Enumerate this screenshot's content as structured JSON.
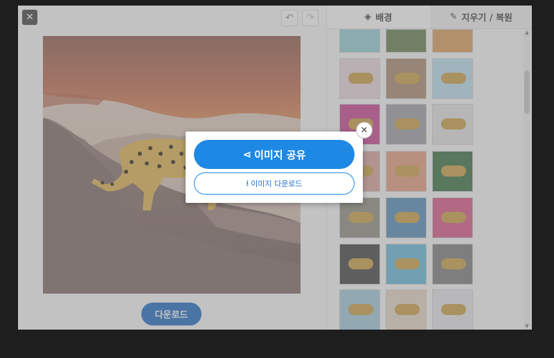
{
  "toolbar": {
    "close_icon": "close-icon",
    "undo_icon": "undo-icon",
    "redo_icon": "redo-icon"
  },
  "tabs": [
    {
      "label": "배경",
      "icon": "layers-icon"
    },
    {
      "label": "지우기 / 복원",
      "icon": "brush-icon"
    }
  ],
  "main": {
    "download_label": "다운로드"
  },
  "modal": {
    "share_label": "이미지 공유",
    "share_icon": "share-icon",
    "download_label": "이미지 다운로드",
    "download_icon": "download-icon",
    "close_icon": "close-icon"
  },
  "colors": {
    "primary": "#1e88e5",
    "download_button": "#1565c0"
  }
}
